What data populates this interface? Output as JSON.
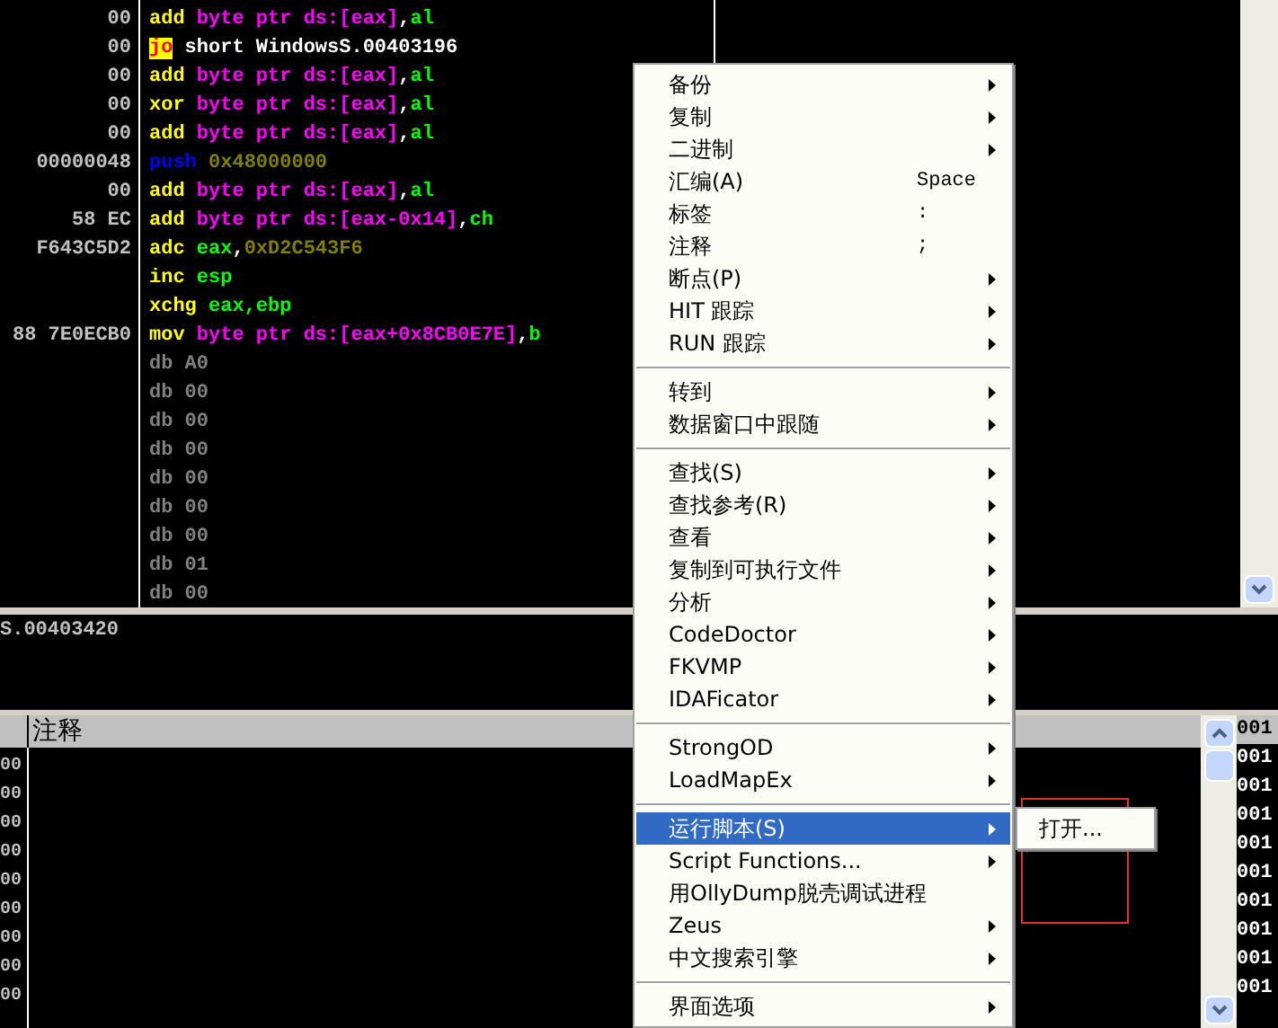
{
  "disassembly": {
    "rows": [
      {
        "bytes": "00",
        "parts": [
          {
            "text": "add ",
            "kind": "mnemonic"
          },
          {
            "text": "byte ptr ds:[eax]",
            "kind": "memory"
          },
          {
            "text": ",",
            "kind": "plain"
          },
          {
            "text": "al",
            "kind": "register"
          }
        ]
      },
      {
        "bytes": "00",
        "parts": [
          {
            "text": "jo",
            "kind": "jump"
          },
          {
            "text": " short WindowsS.00403196",
            "kind": "plain"
          }
        ]
      },
      {
        "bytes": "00",
        "parts": [
          {
            "text": "add ",
            "kind": "mnemonic"
          },
          {
            "text": "byte ptr ds:[eax]",
            "kind": "memory"
          },
          {
            "text": ",",
            "kind": "plain"
          },
          {
            "text": "al",
            "kind": "register"
          }
        ]
      },
      {
        "bytes": "00",
        "parts": [
          {
            "text": "xor ",
            "kind": "mnemonic"
          },
          {
            "text": "byte ptr ds:[eax]",
            "kind": "memory"
          },
          {
            "text": ",",
            "kind": "plain"
          },
          {
            "text": "al",
            "kind": "register"
          }
        ]
      },
      {
        "bytes": "00",
        "parts": [
          {
            "text": "add ",
            "kind": "mnemonic"
          },
          {
            "text": "byte ptr ds:[eax]",
            "kind": "memory"
          },
          {
            "text": ",",
            "kind": "plain"
          },
          {
            "text": "al",
            "kind": "register"
          }
        ]
      },
      {
        "bytes": "00000048",
        "parts": [
          {
            "text": "push ",
            "kind": "push"
          },
          {
            "text": "0x48000000",
            "kind": "constant"
          }
        ]
      },
      {
        "bytes": "00",
        "parts": [
          {
            "text": "add ",
            "kind": "mnemonic"
          },
          {
            "text": "byte ptr ds:[eax]",
            "kind": "memory"
          },
          {
            "text": ",",
            "kind": "plain"
          },
          {
            "text": "al",
            "kind": "register"
          }
        ]
      },
      {
        "bytes": "58 EC",
        "parts": [
          {
            "text": "add ",
            "kind": "mnemonic"
          },
          {
            "text": "byte ptr ds:[eax-0x14]",
            "kind": "memory"
          },
          {
            "text": ",",
            "kind": "plain"
          },
          {
            "text": "ch",
            "kind": "register"
          }
        ]
      },
      {
        "bytes": "F643C5D2",
        "parts": [
          {
            "text": "adc ",
            "kind": "mnemonic"
          },
          {
            "text": "eax",
            "kind": "register"
          },
          {
            "text": ",",
            "kind": "plain"
          },
          {
            "text": "0xD2C543F6",
            "kind": "constant"
          }
        ]
      },
      {
        "parts": [
          {
            "text": "inc ",
            "kind": "mnemonic"
          },
          {
            "text": "esp",
            "kind": "register"
          }
        ]
      },
      {
        "parts": [
          {
            "text": "xchg ",
            "kind": "mnemonic"
          },
          {
            "text": "eax,ebp",
            "kind": "register"
          }
        ]
      },
      {
        "bytes": "88 7E0ECB0",
        "parts": [
          {
            "text": "mov ",
            "kind": "mnemonic"
          },
          {
            "text": "byte ptr ds:[eax+0x8CB0E7E]",
            "kind": "memory"
          },
          {
            "text": ",",
            "kind": "plain"
          },
          {
            "text": "b",
            "kind": "register"
          }
        ]
      },
      {
        "parts": [
          {
            "text": "db A0",
            "kind": "data"
          }
        ]
      },
      {
        "parts": [
          {
            "text": "db 00",
            "kind": "data"
          }
        ]
      },
      {
        "parts": [
          {
            "text": "db 00",
            "kind": "data"
          }
        ]
      },
      {
        "parts": [
          {
            "text": "db 00",
            "kind": "data"
          }
        ]
      },
      {
        "parts": [
          {
            "text": "db 00",
            "kind": "data"
          }
        ]
      },
      {
        "parts": [
          {
            "text": "db 00",
            "kind": "data"
          }
        ]
      },
      {
        "parts": [
          {
            "text": "db 00",
            "kind": "data"
          }
        ]
      },
      {
        "parts": [
          {
            "text": "db 01",
            "kind": "data"
          }
        ]
      },
      {
        "parts": [
          {
            "text": "db 00",
            "kind": "data"
          }
        ]
      }
    ]
  },
  "info_pane": {
    "text": "S.00403420"
  },
  "comment_pane": {
    "header": "注释",
    "rows": [
      "00",
      "00",
      "00",
      "00",
      "00",
      "00",
      "00",
      "00",
      "00"
    ]
  },
  "stack_pane": {
    "rows": [
      "001",
      "001",
      "001",
      "001",
      "001",
      "001",
      "001",
      "001",
      "001",
      "001"
    ]
  },
  "context_menu": {
    "groups": [
      [
        {
          "label": "备份",
          "submenu": true,
          "selected": false
        },
        {
          "label": "复制",
          "submenu": true,
          "selected": false
        },
        {
          "label": "二进制",
          "submenu": true,
          "selected": false
        },
        {
          "label": "汇编(A)",
          "shortcut": "Space",
          "submenu": false,
          "selected": false
        },
        {
          "label": "标签",
          "shortcut": ":",
          "submenu": false,
          "selected": false
        },
        {
          "label": "注释",
          "shortcut": ";",
          "submenu": false,
          "selected": false
        },
        {
          "label": "断点(P)",
          "submenu": true,
          "selected": false
        },
        {
          "label": "HIT 跟踪",
          "submenu": true,
          "selected": false
        },
        {
          "label": "RUN 跟踪",
          "submenu": true,
          "selected": false
        }
      ],
      [
        {
          "label": "转到",
          "submenu": true,
          "selected": false
        },
        {
          "label": "数据窗口中跟随",
          "submenu": true,
          "selected": false
        }
      ],
      [
        {
          "label": "查找(S)",
          "submenu": true,
          "selected": false
        },
        {
          "label": "查找参考(R)",
          "submenu": true,
          "selected": false
        },
        {
          "label": "查看",
          "submenu": true,
          "selected": false
        },
        {
          "label": "复制到可执行文件",
          "submenu": true,
          "selected": false
        },
        {
          "label": "分析",
          "submenu": true,
          "selected": false
        },
        {
          "label": "CodeDoctor",
          "submenu": true,
          "selected": false
        },
        {
          "label": "FKVMP",
          "submenu": true,
          "selected": false
        },
        {
          "label": "IDAFicator",
          "submenu": true,
          "selected": false
        }
      ],
      [
        {
          "label": "StrongOD",
          "submenu": true,
          "selected": false
        },
        {
          "label": "LoadMapEx",
          "submenu": true,
          "selected": false
        }
      ],
      [
        {
          "label": "运行脚本(S)",
          "submenu": true,
          "selected": true
        },
        {
          "label": "Script Functions...",
          "submenu": true,
          "selected": false
        },
        {
          "label": "用OllyDump脱壳调试进程",
          "submenu": false,
          "selected": false
        },
        {
          "label": "Zeus",
          "submenu": true,
          "selected": false
        },
        {
          "label": "中文搜索引擎",
          "submenu": true,
          "selected": false
        }
      ],
      [
        {
          "label": "界面选项",
          "submenu": true,
          "selected": false
        }
      ]
    ],
    "submenu": {
      "items": [
        "打开..."
      ]
    }
  }
}
